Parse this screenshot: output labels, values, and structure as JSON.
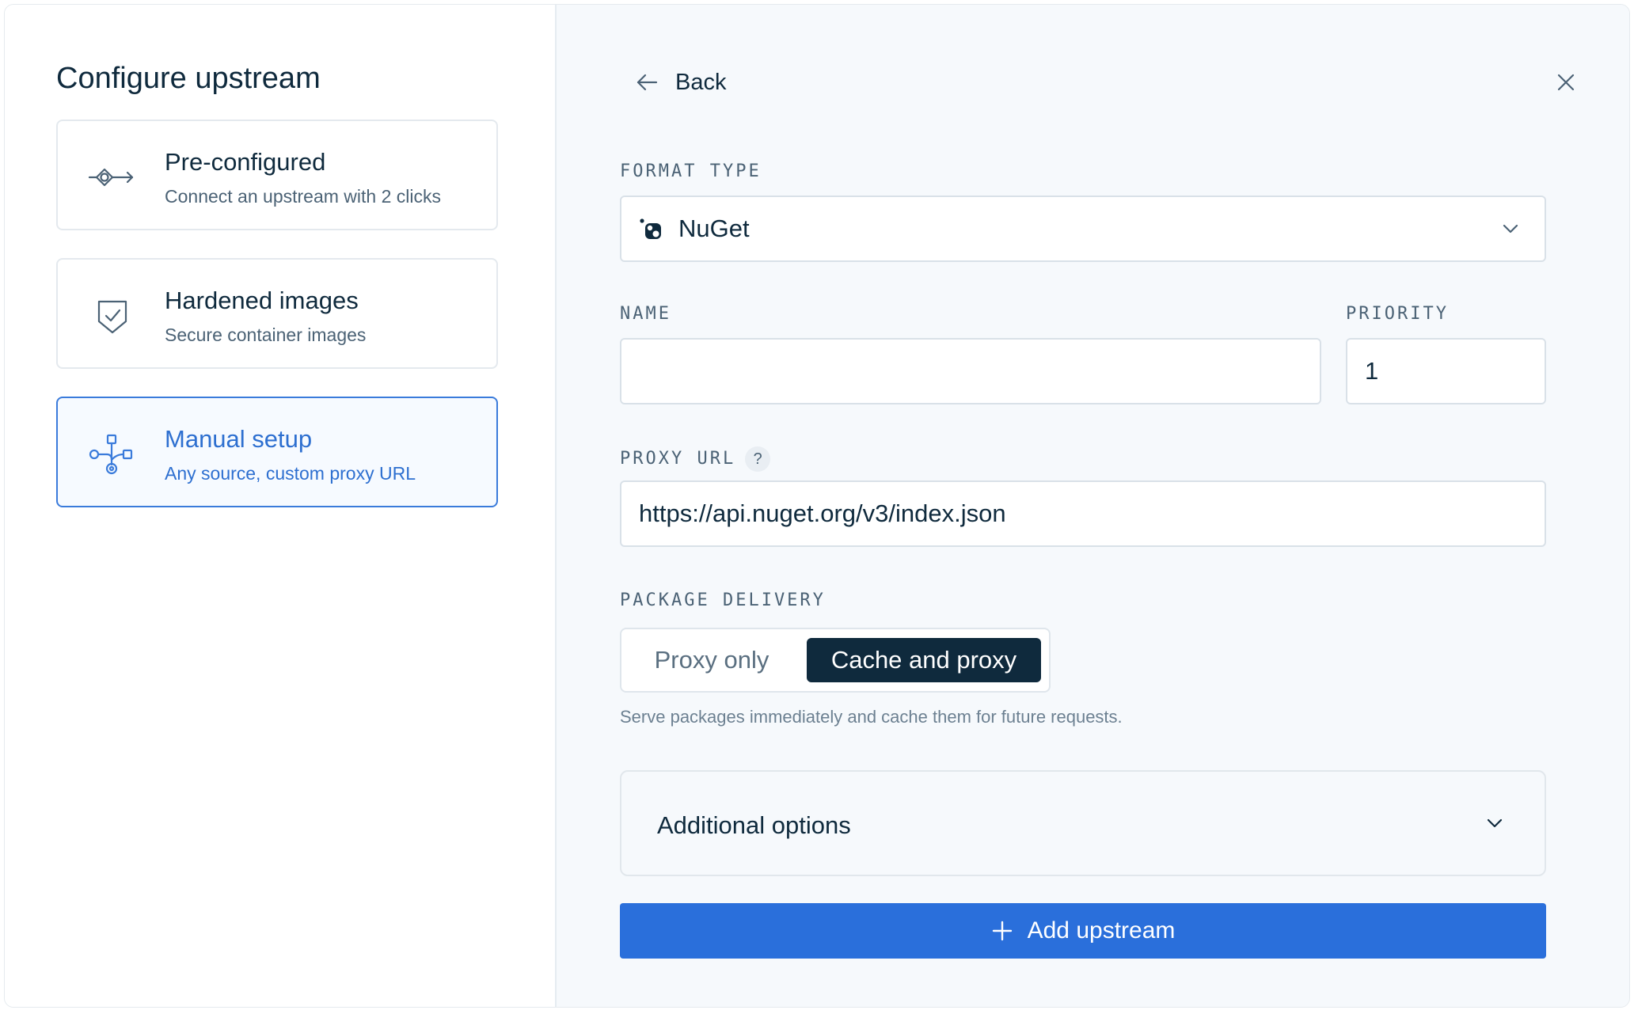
{
  "left_panel": {
    "title": "Configure upstream",
    "options": [
      {
        "title": "Pre-configured",
        "subtitle": "Connect an upstream with 2 clicks",
        "icon": "connector-icon",
        "selected": false
      },
      {
        "title": "Hardened images",
        "subtitle": "Secure container images",
        "icon": "shield-check-icon",
        "selected": false
      },
      {
        "title": "Manual setup",
        "subtitle": "Any source, custom proxy URL",
        "icon": "network-nodes-icon",
        "selected": true
      }
    ]
  },
  "header": {
    "back_label": "Back",
    "close_icon": "close-icon"
  },
  "form": {
    "format_type": {
      "label": "FORMAT TYPE",
      "value": "NuGet",
      "icon": "nuget-icon"
    },
    "name": {
      "label": "NAME",
      "value": ""
    },
    "priority": {
      "label": "PRIORITY",
      "value": "1"
    },
    "proxy_url": {
      "label": "PROXY URL",
      "help": "?",
      "value": "https://api.nuget.org/v3/index.json"
    },
    "package_delivery": {
      "label": "PACKAGE DELIVERY",
      "options": [
        "Proxy only",
        "Cache and proxy"
      ],
      "selected": "Cache and proxy",
      "hint": "Serve packages immediately and cache them for future requests."
    },
    "additional_options": {
      "label": "Additional options",
      "expanded": false
    },
    "submit_label": "Add upstream"
  },
  "colors": {
    "accent": "#2a6fdb",
    "dark": "#0f2a3d",
    "selected_border": "#3a7bdb"
  }
}
